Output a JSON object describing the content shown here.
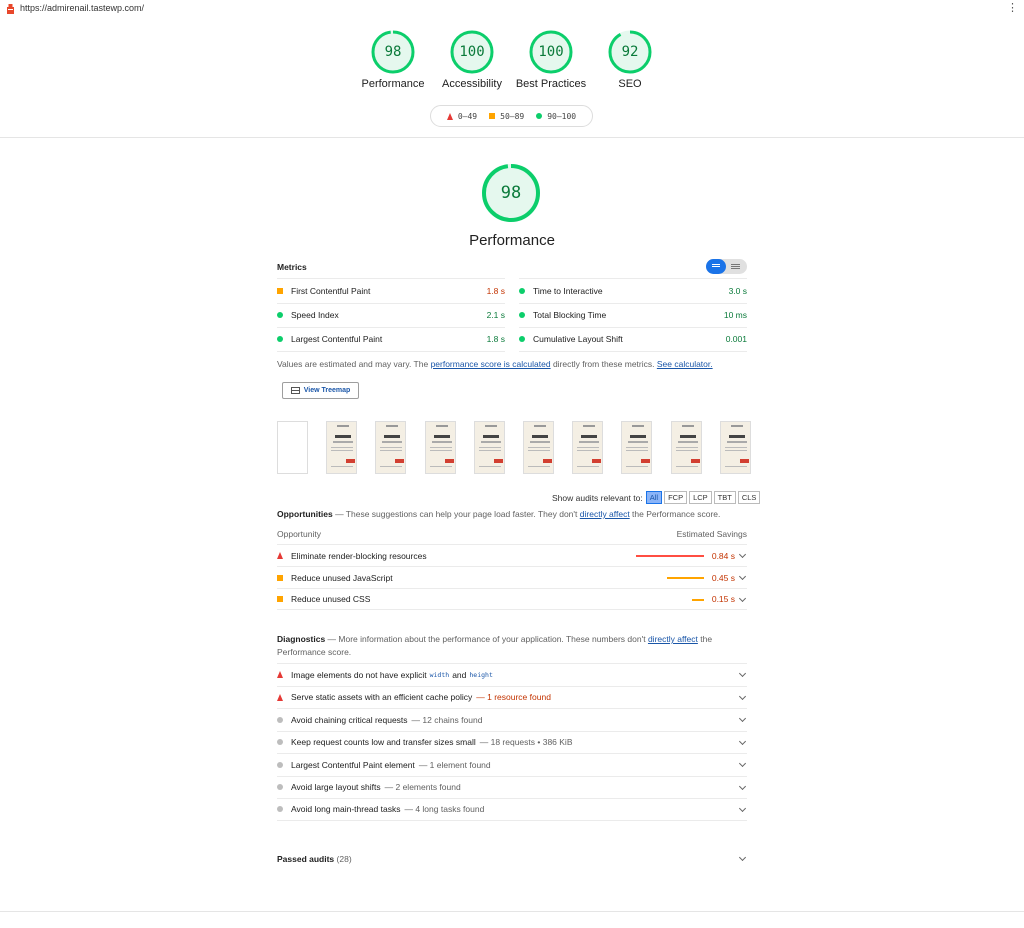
{
  "browser": {
    "url": "https://admirenail.tastewp.com/"
  },
  "categories": [
    {
      "score": "98",
      "label": "Performance",
      "value": 0.98
    },
    {
      "score": "100",
      "label": "Accessibility",
      "value": 1.0
    },
    {
      "score": "100",
      "label": "Best Practices",
      "value": 1.0
    },
    {
      "score": "92",
      "label": "SEO",
      "value": 0.92
    }
  ],
  "legend": {
    "fail": "0–49",
    "average": "50–89",
    "pass": "90–100"
  },
  "performance": {
    "score": "98",
    "title": "Performance",
    "value": 0.98
  },
  "metrics": {
    "heading": "Metrics",
    "left": [
      {
        "label": "First Contentful Paint",
        "value": "1.8 s",
        "status": "average"
      },
      {
        "label": "Speed Index",
        "value": "2.1 s",
        "status": "pass"
      },
      {
        "label": "Largest Contentful Paint",
        "value": "1.8 s",
        "status": "pass"
      }
    ],
    "right": [
      {
        "label": "Time to Interactive",
        "value": "3.0 s",
        "status": "pass"
      },
      {
        "label": "Total Blocking Time",
        "value": "10 ms",
        "status": "pass"
      },
      {
        "label": "Cumulative Layout Shift",
        "value": "0.001",
        "status": "pass"
      }
    ],
    "note_prefix": "Values are estimated and may vary. The ",
    "note_link1": "performance score is calculated",
    "note_middle": " directly from these metrics. ",
    "note_link2": "See calculator."
  },
  "treemap_button": "View Treemap",
  "filmstrip_frames": 10,
  "audit_filter": {
    "label": "Show audits relevant to:",
    "chips": [
      "All",
      "FCP",
      "LCP",
      "TBT",
      "CLS"
    ]
  },
  "opportunities": {
    "title": "Opportunities",
    "desc_prefix": " — These suggestions can help your page load faster. They don't ",
    "desc_link": "directly affect",
    "desc_suffix": " the Performance score.",
    "col_left": "Opportunity",
    "col_right": "Estimated Savings",
    "items": [
      {
        "label": "Eliminate render-blocking resources",
        "savings": "0.84 s",
        "status": "fail",
        "fraction": 1.0
      },
      {
        "label": "Reduce unused JavaScript",
        "savings": "0.45 s",
        "status": "average",
        "fraction": 0.54
      },
      {
        "label": "Reduce unused CSS",
        "savings": "0.15 s",
        "status": "average",
        "fraction": 0.18
      }
    ]
  },
  "diagnostics": {
    "title": "Diagnostics",
    "desc_prefix": " — More information about the performance of your application. These numbers don't ",
    "desc_link": "directly affect",
    "desc_suffix": " the Performance score.",
    "items": [
      {
        "label": "Image elements do not have explicit",
        "code1": "width",
        "and": "and",
        "code2": "height",
        "extra": "",
        "status": "fail"
      },
      {
        "label": "Serve static assets with an efficient cache policy",
        "extra": "— 1 resource found",
        "status": "fail"
      },
      {
        "label": "Avoid chaining critical requests",
        "extra": "— 12 chains found",
        "status": "info"
      },
      {
        "label": "Keep request counts low and transfer sizes small",
        "extra": "— 18 requests • 386 KiB",
        "status": "info"
      },
      {
        "label": "Largest Contentful Paint element",
        "extra": "— 1 element found",
        "status": "info"
      },
      {
        "label": "Avoid large layout shifts",
        "extra": "— 2 elements found",
        "status": "info"
      },
      {
        "label": "Avoid long main-thread tasks",
        "extra": "— 4 long tasks found",
        "status": "info"
      }
    ]
  },
  "passed": {
    "label": "Passed audits",
    "count": "(28)"
  },
  "colors": {
    "pass": "#0cce6b",
    "average": "#ffa400",
    "fail": "#ff4e42"
  }
}
